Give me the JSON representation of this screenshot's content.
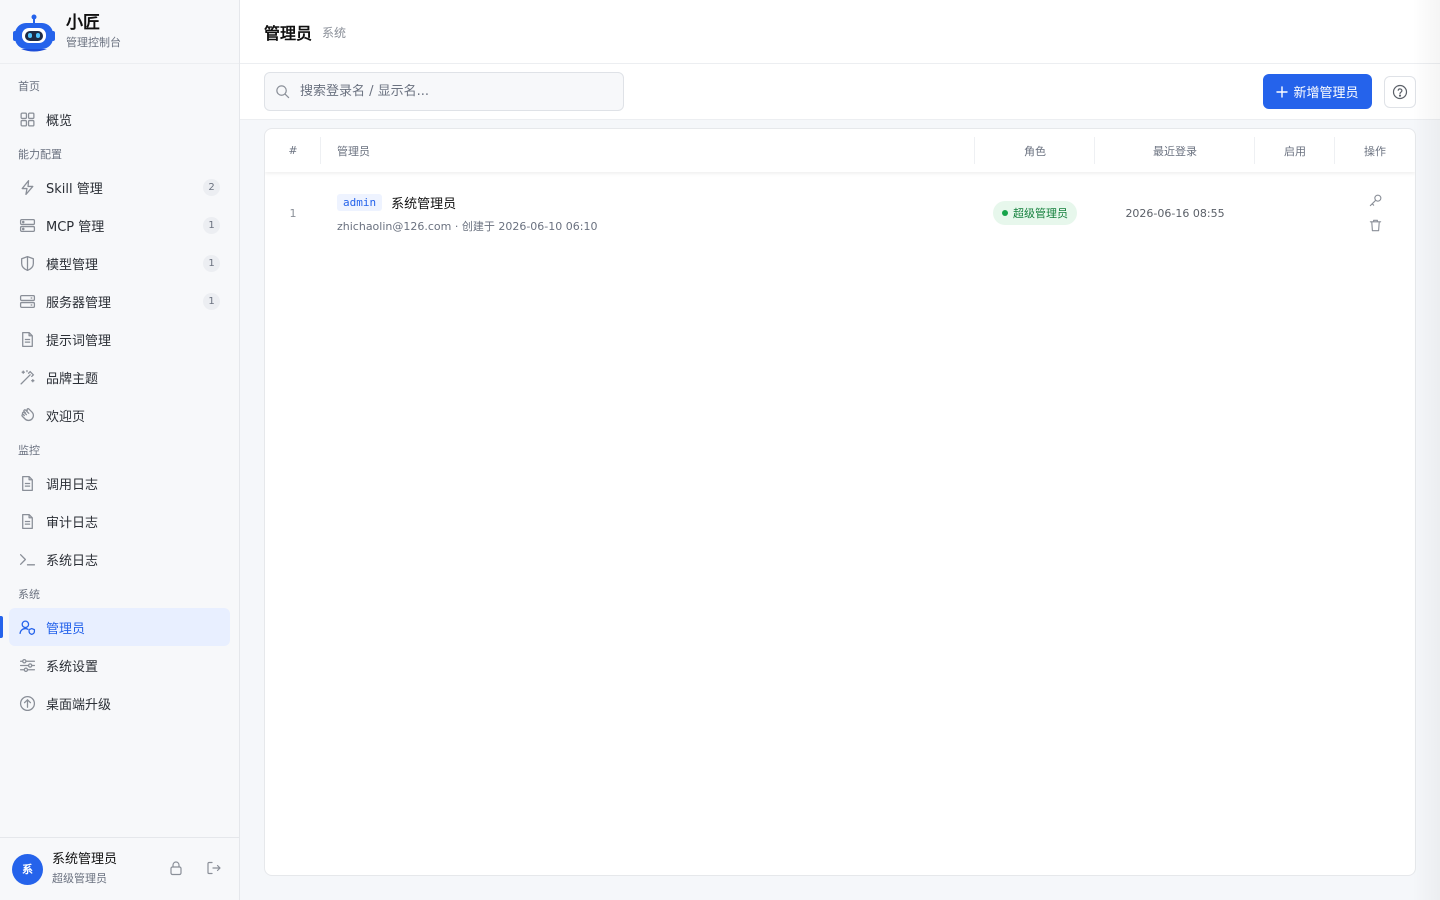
{
  "brand": {
    "title": "小匠",
    "subtitle": "管理控制台"
  },
  "nav": {
    "sections": [
      {
        "label": "首页",
        "items": [
          {
            "label": "概览",
            "icon": "grid-icon"
          }
        ]
      },
      {
        "label": "能力配置",
        "items": [
          {
            "label": "Skill 管理",
            "icon": "lightning-icon",
            "badge": "2"
          },
          {
            "label": "MCP 管理",
            "icon": "server-icon",
            "badge": "1"
          },
          {
            "label": "模型管理",
            "icon": "shield-icon",
            "badge": "1"
          },
          {
            "label": "服务器管理",
            "icon": "server-stack-icon",
            "badge": "1"
          },
          {
            "label": "提示词管理",
            "icon": "document-icon"
          },
          {
            "label": "品牌主题",
            "icon": "magic-wand-icon"
          },
          {
            "label": "欢迎页",
            "icon": "hand-wave-icon"
          }
        ]
      },
      {
        "label": "监控",
        "items": [
          {
            "label": "调用日志",
            "icon": "document-icon"
          },
          {
            "label": "审计日志",
            "icon": "document-icon"
          },
          {
            "label": "系统日志",
            "icon": "terminal-icon"
          }
        ]
      },
      {
        "label": "系统",
        "items": [
          {
            "label": "管理员",
            "icon": "user-shield-icon",
            "active": true
          },
          {
            "label": "系统设置",
            "icon": "sliders-icon"
          },
          {
            "label": "桌面端升级",
            "icon": "upgrade-circle-icon"
          }
        ]
      }
    ]
  },
  "user": {
    "avatar_text": "系",
    "name": "系统管理员",
    "role": "超级管理员"
  },
  "header": {
    "title": "管理员",
    "crumb": "系统"
  },
  "toolbar": {
    "search_placeholder": "搜索登录名 / 显示名...",
    "add_button": "新增管理员"
  },
  "table": {
    "columns": {
      "num": "#",
      "admin": "管理员",
      "role": "角色",
      "last_login": "最近登录",
      "enabled": "启用",
      "ops": "操作"
    },
    "rows": [
      {
        "num": "1",
        "login": "admin",
        "display_name": "系统管理员",
        "meta": "zhichaolin@126.com · 创建于 2026-06-10 06:10",
        "role": "超级管理员",
        "last_login": "2026-06-16 08:55",
        "enabled": ""
      }
    ]
  },
  "colors": {
    "primary": "#2563eb",
    "success": "#16a34a",
    "sidebar_bg": "#f7f8fa"
  }
}
